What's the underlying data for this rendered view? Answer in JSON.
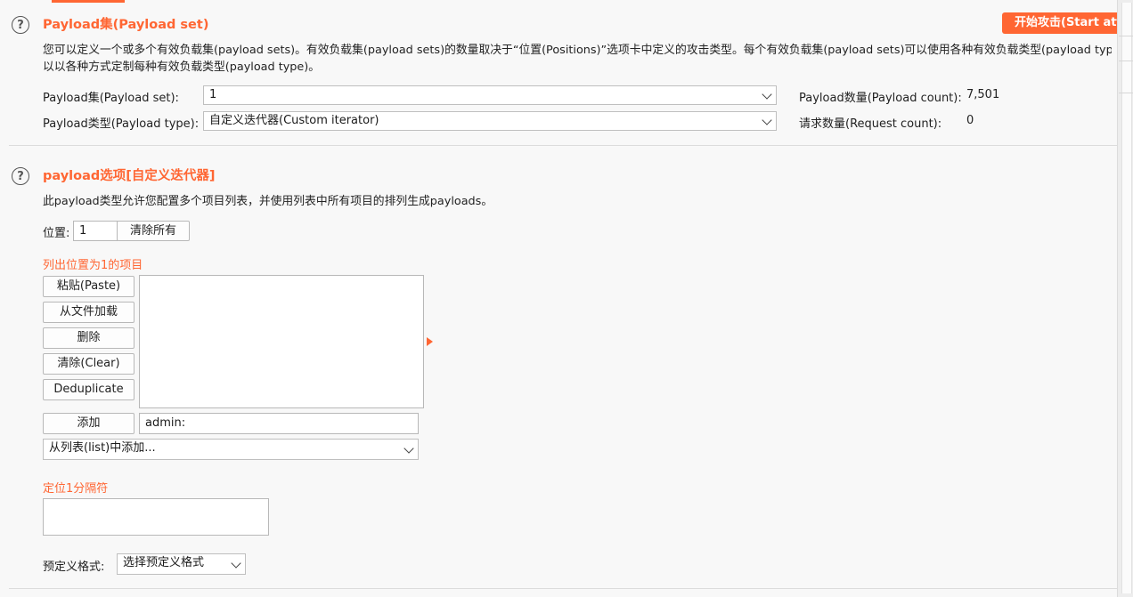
{
  "payload_sets": {
    "title": "Payload集(Payload set)",
    "start_attack_label": "开始攻击(Start attack)",
    "description_line1": "您可以定义一个或多个有效负载集(payload sets)。有效负载集(payload sets)的数量取决于“位置(Positions)”选项卡中定义的攻击类型。每个有效负载集(payload sets)可以使用各种有效负载类型(payload type)，每种有效负载类型(payload type)可",
    "description_line2": "以以各种方式定制每种有效负载类型(payload type)。",
    "set_label": "Payload集(Payload set):",
    "set_value": "1",
    "type_label": "Payload类型(Payload type):",
    "type_value": "自定义迭代器(Custom iterator)",
    "payload_count_label": "Payload数量(Payload count):",
    "payload_count_value": "7,501",
    "request_count_label": "请求数量(Request count):",
    "request_count_value": "0"
  },
  "payload_options": {
    "title": "payload选项[自定义迭代器]",
    "description": "此payload类型允许您配置多个项目列表，并使用列表中所有项目的排列生成payloads。",
    "position_label": "位置:",
    "position_value": "1",
    "clear_all_label": "清除所有",
    "list_heading": "列出位置为1的项目",
    "paste_label": "粘贴(Paste)",
    "load_label": "从文件加载",
    "remove_label": "删除",
    "clear_label": "清除(Clear)",
    "dedup_label": "Deduplicate",
    "add_label": "添加",
    "add_input_value": "admin:",
    "add_from_list_value": "从列表(list)中添加...",
    "separator_heading": "定位1分隔符",
    "separator_value": "",
    "predefined_label": "预定义格式:",
    "predefined_value": "选择预定义格式"
  },
  "icons": {
    "help": "?"
  },
  "colors": {
    "accent": "#ff6633"
  }
}
